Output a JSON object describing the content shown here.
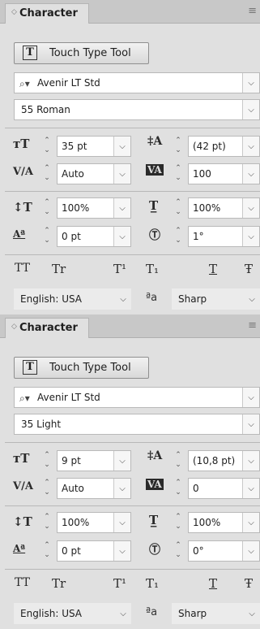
{
  "panels": [
    {
      "title": "Character",
      "touch_type_label": "Touch Type Tool",
      "font_family": "Avenir LT Std",
      "font_style": "55 Roman",
      "font_size": "35 pt",
      "leading": "(42 pt)",
      "kerning": "Auto",
      "tracking": "100",
      "vertical_scale": "100%",
      "horizontal_scale": "100%",
      "baseline_shift": "0 pt",
      "rotation": "1°",
      "language": "English: USA",
      "aa_label": "ªa",
      "antialias": "Sharp"
    },
    {
      "title": "Character",
      "touch_type_label": "Touch Type Tool",
      "font_family": "Avenir LT Std",
      "font_style": "35 Light",
      "font_size": "9 pt",
      "leading": "(10,8 pt)",
      "kerning": "Auto",
      "tracking": "0",
      "vertical_scale": "100%",
      "horizontal_scale": "100%",
      "baseline_shift": "0 pt",
      "rotation": "0°",
      "language": "English: USA",
      "aa_label": "ªa",
      "antialias": "Sharp"
    }
  ],
  "style_buttons": [
    "TT",
    "Tr",
    "T¹",
    "T₁",
    "T",
    "Ŧ"
  ],
  "icons": {
    "chevron": "◇",
    "menu": "≡",
    "dropdown": "⌵",
    "search": "⌕"
  }
}
